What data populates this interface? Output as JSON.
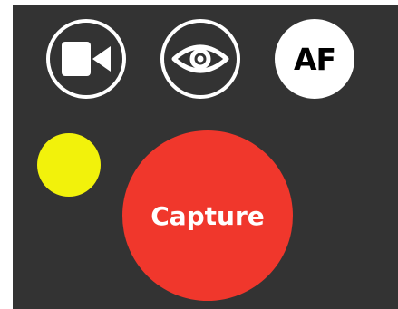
{
  "colors": {
    "panel_background": "#333333",
    "button_outline": "#ffffff",
    "indicator": "#f2f20b",
    "capture": "#f0372c"
  },
  "toolbar": {
    "video_icon": "video-camera-icon",
    "eye_icon": "eye-icon",
    "af_label": "AF"
  },
  "indicator": {
    "icon": "status-dot"
  },
  "capture": {
    "label": "Capture"
  }
}
